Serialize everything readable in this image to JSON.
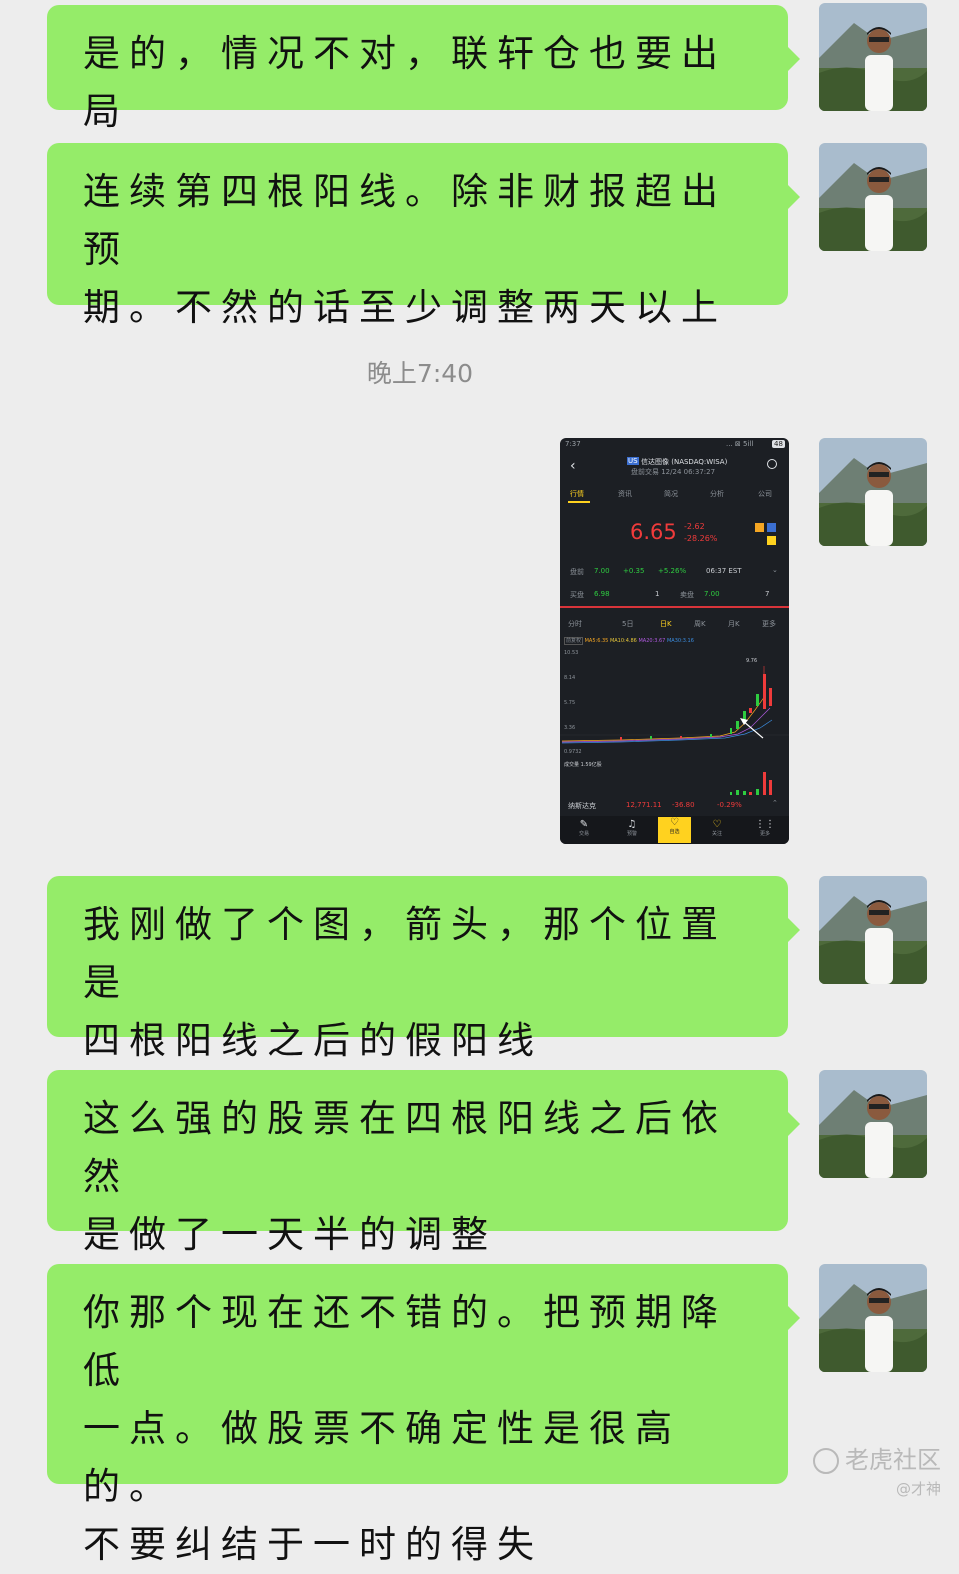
{
  "messages": [
    {
      "text": "是的，情况不对，联轩仓也要出局"
    },
    {
      "text": "连续第四根阳线。除非财报超出预\n期。不然的话至少调整两天以上"
    },
    {
      "text": "我刚做了个图，箭头，那个位置是\n四根阳线之后的假阳线"
    },
    {
      "text": "这么强的股票在四根阳线之后依然\n是做了一天半的调整"
    },
    {
      "text": "你那个现在还不错的。把预期降低\n一点。做股票不确定性是很高的。\n不要纠结于一时的得失"
    }
  ],
  "timestamp": "晚上7:40",
  "screenshot": {
    "status_time": "7:37",
    "status_icons": "... ⊠ 5ill",
    "battery": "48",
    "stock_badge": "US",
    "stock_name": "信达图像 (NASDAQ:WISA)",
    "stock_sub": "盘前交易 12/24 06:37:27",
    "tabs": [
      "行情",
      "资讯",
      "简况",
      "分析",
      "公司"
    ],
    "price": "6.65",
    "change": "-2.62",
    "change_pct": "-28.26%",
    "pre_label": "盘前",
    "pre_price": "7.00",
    "pre_change": "+0.35",
    "pre_pct": "+5.26%",
    "pre_time": "06:37 EST",
    "buy_label": "买盘",
    "buy_price": "6.98",
    "buy_qty": "1",
    "sell_label": "卖盘",
    "sell_price": "7.00",
    "sell_qty": "7",
    "period_tabs": [
      "分时",
      "5日",
      "日K",
      "周K",
      "月K",
      "更多"
    ],
    "ma_row": [
      "前复权",
      "MA5:6.35",
      "MA10:4.86",
      "MA20:3.67",
      "MA30:3.16"
    ],
    "y_ticks": [
      "10.53",
      "8.14",
      "5.75",
      "3.36",
      "0.9732"
    ],
    "high_label": "9.76",
    "vol_label": "成交量 1.59亿股",
    "index_name": "纳斯达克",
    "index_value": "12,771.11",
    "index_change": "-36.80",
    "index_pct": "-0.29%",
    "nav": [
      "交易",
      "预警",
      "自选",
      "关注",
      "更多"
    ],
    "colors": {
      "up": "#ef3b3b",
      "down": "#2ecc40",
      "accent": "#ffd21f",
      "bg": "#1c1f24"
    }
  },
  "watermark": {
    "brand": "老虎社区",
    "user": "@才神"
  }
}
